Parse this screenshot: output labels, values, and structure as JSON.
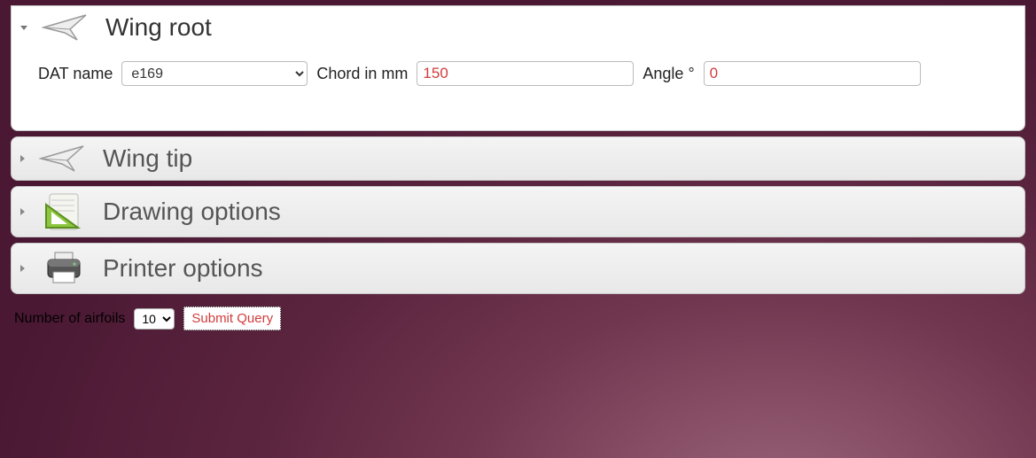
{
  "panels": {
    "root": {
      "title": "Wing root",
      "dat_label": "DAT name",
      "dat_value": "e169",
      "chord_label": "Chord in mm",
      "chord_value": "150",
      "angle_label": "Angle °",
      "angle_value": "0"
    },
    "tip": {
      "title": "Wing tip"
    },
    "drawing": {
      "title": "Drawing options"
    },
    "printer": {
      "title": "Printer options"
    }
  },
  "bottom": {
    "count_label": "Number of airfoils",
    "count_value": "10",
    "submit_label": "Submit Query"
  }
}
